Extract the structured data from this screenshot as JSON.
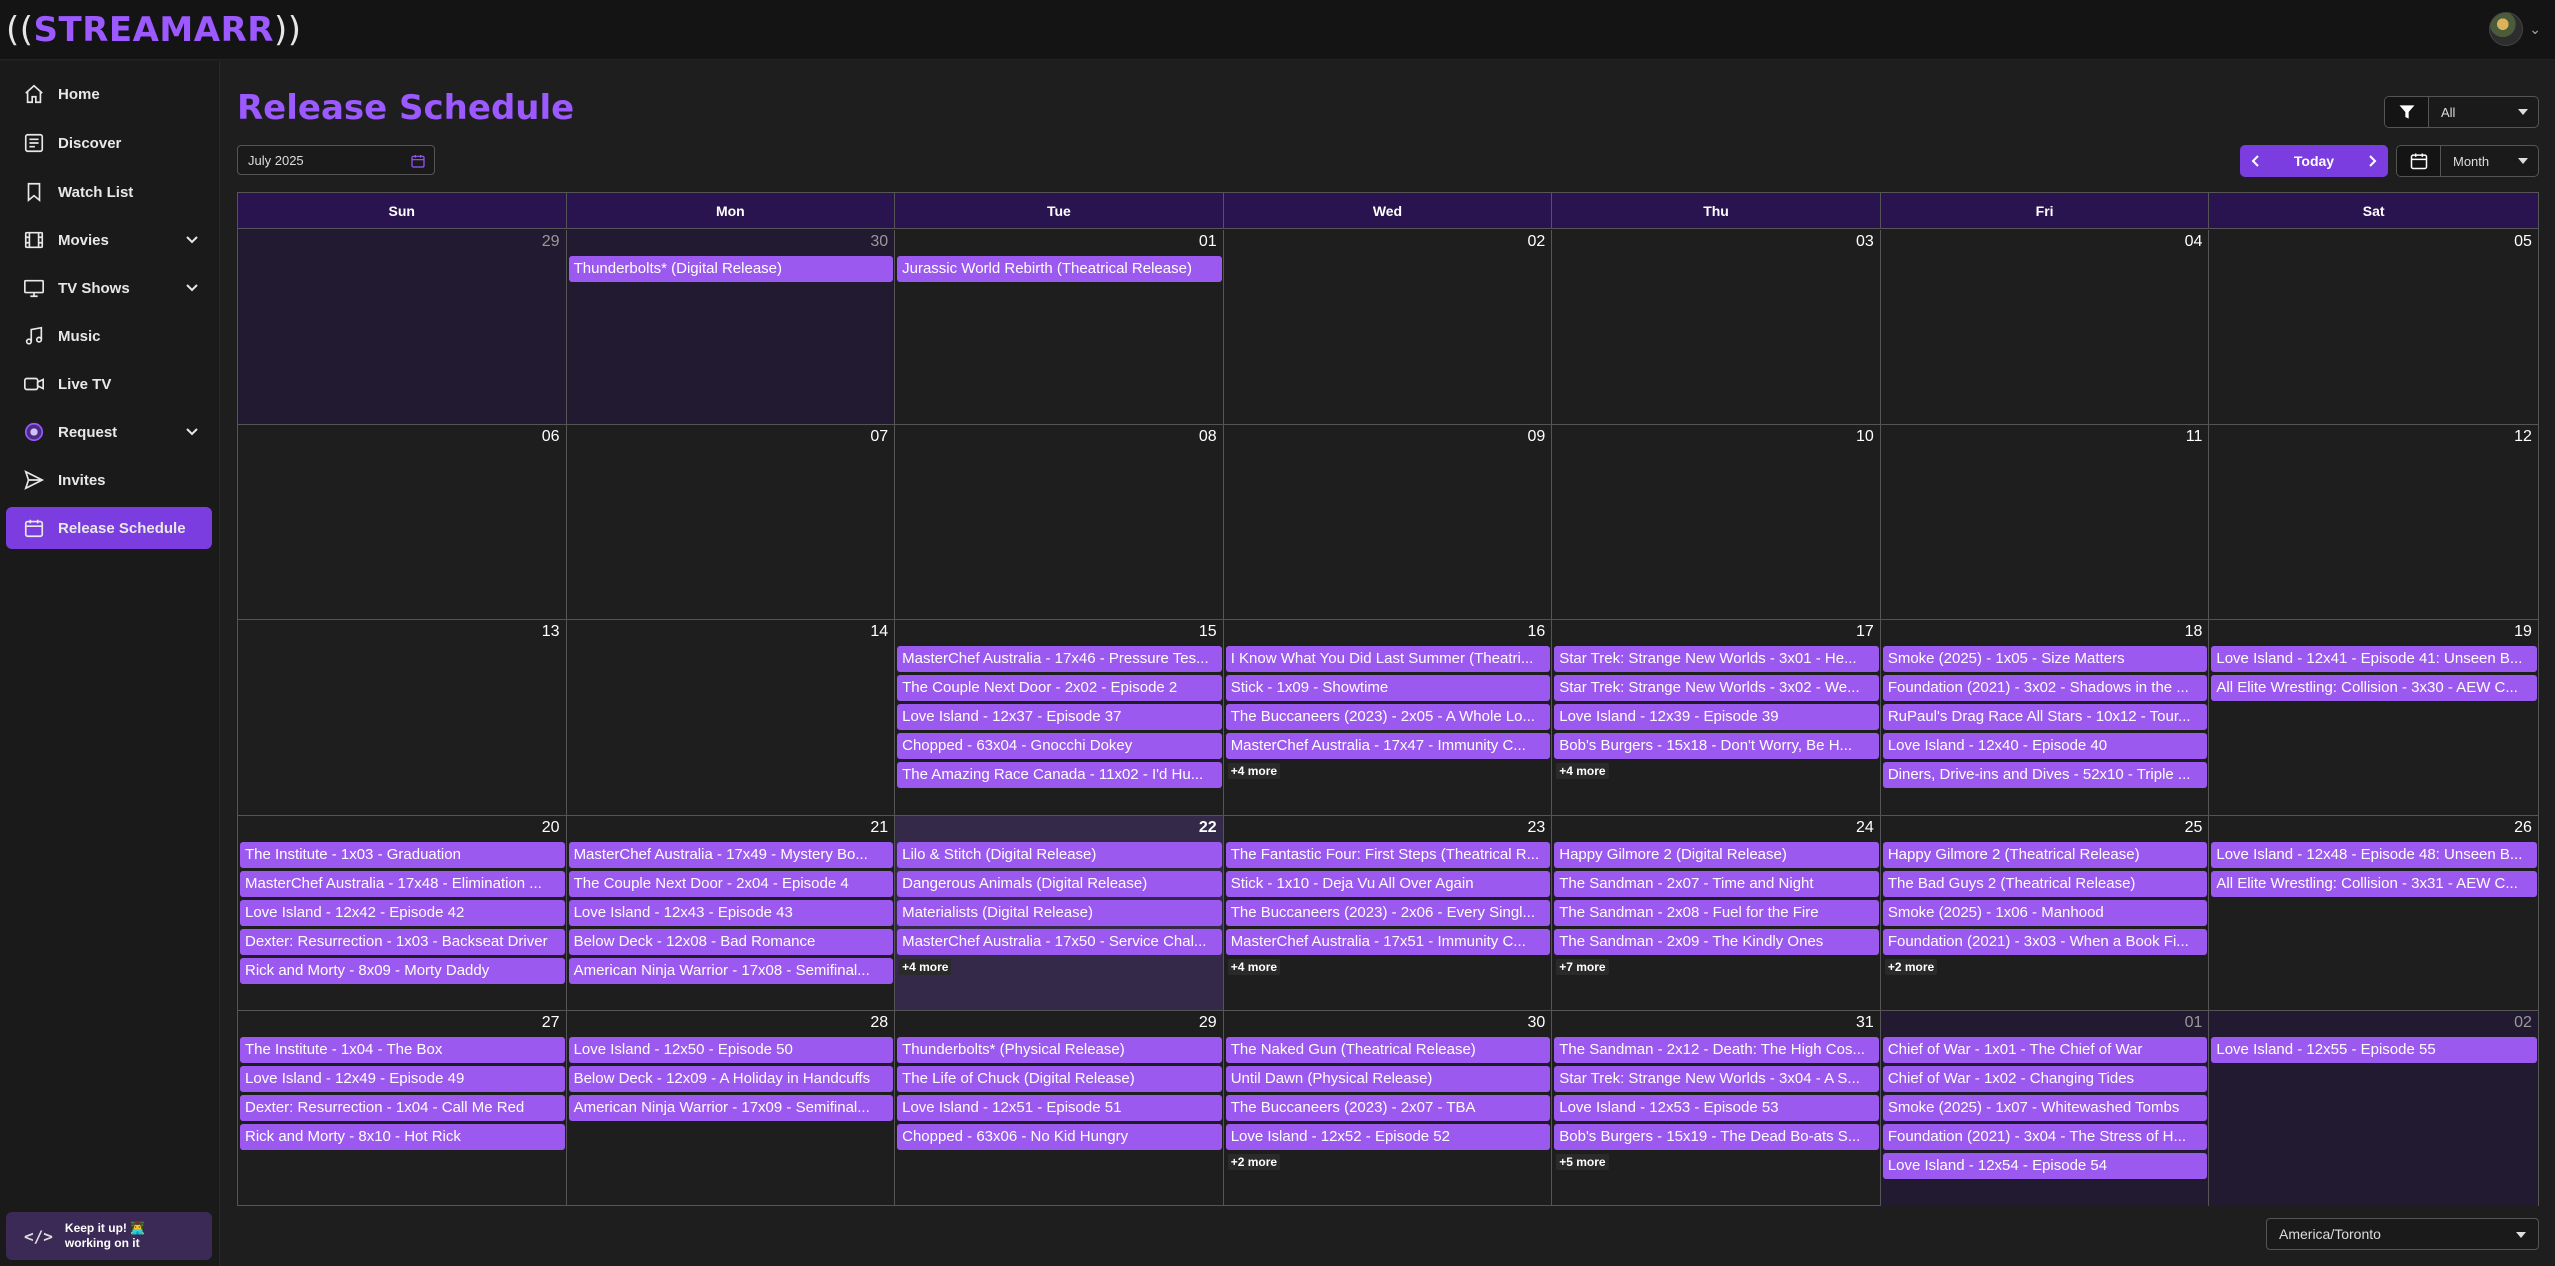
{
  "app": {
    "logo_name": "STREAMARR",
    "logo_left": "((",
    "logo_right": "))"
  },
  "sidebar": {
    "items": [
      {
        "label": "Home",
        "icon": "home-icon"
      },
      {
        "label": "Discover",
        "icon": "discover-icon"
      },
      {
        "label": "Watch List",
        "icon": "bookmark-icon"
      },
      {
        "label": "Movies",
        "icon": "film-icon",
        "expandable": true
      },
      {
        "label": "TV Shows",
        "icon": "tv-icon",
        "expandable": true
      },
      {
        "label": "Music",
        "icon": "music-icon"
      },
      {
        "label": "Live TV",
        "icon": "video-camera-icon"
      },
      {
        "label": "Request",
        "icon": "request-icon",
        "expandable": true
      },
      {
        "label": "Invites",
        "icon": "send-icon"
      },
      {
        "label": "Release Schedule",
        "icon": "calendar-icon",
        "active": true
      }
    ],
    "footer": {
      "line1": "Keep it up! 👨‍💻",
      "line2": "working on it",
      "icon": "code-icon"
    }
  },
  "header": {
    "title": "Release Schedule",
    "date_value": "July 2025",
    "filter_value": "All",
    "today_label": "Today",
    "view_value": "Month"
  },
  "calendar": {
    "weekdays": [
      "Sun",
      "Mon",
      "Tue",
      "Wed",
      "Thu",
      "Fri",
      "Sat"
    ],
    "weeks": [
      [
        {
          "day": "29",
          "other": true,
          "events": []
        },
        {
          "day": "30",
          "other": true,
          "events": [
            "Thunderbolts* (Digital Release)"
          ]
        },
        {
          "day": "01",
          "events": [
            "Jurassic World Rebirth (Theatrical Release)"
          ]
        },
        {
          "day": "02",
          "events": []
        },
        {
          "day": "03",
          "events": []
        },
        {
          "day": "04",
          "events": []
        },
        {
          "day": "05",
          "events": []
        }
      ],
      [
        {
          "day": "06",
          "events": []
        },
        {
          "day": "07",
          "events": []
        },
        {
          "day": "08",
          "events": []
        },
        {
          "day": "09",
          "events": []
        },
        {
          "day": "10",
          "events": []
        },
        {
          "day": "11",
          "events": []
        },
        {
          "day": "12",
          "events": []
        }
      ],
      [
        {
          "day": "13",
          "events": []
        },
        {
          "day": "14",
          "events": []
        },
        {
          "day": "15",
          "events": [
            "MasterChef Australia - 17x46 - Pressure Tes...",
            "The Couple Next Door - 2x02 - Episode 2",
            "Love Island - 12x37 - Episode 37",
            "Chopped - 63x04 - Gnocchi Dokey",
            "The Amazing Race Canada - 11x02 - I'd Hu..."
          ]
        },
        {
          "day": "16",
          "events": [
            "I Know What You Did Last Summer (Theatri...",
            "Stick - 1x09 - Showtime",
            "The Buccaneers (2023) - 2x05 - A Whole Lo...",
            "MasterChef Australia - 17x47 - Immunity C..."
          ],
          "more": "+4 more"
        },
        {
          "day": "17",
          "events": [
            "Star Trek: Strange New Worlds - 3x01 - He...",
            "Star Trek: Strange New Worlds - 3x02 - We...",
            "Love Island - 12x39 - Episode 39",
            "Bob's Burgers - 15x18 - Don't Worry, Be H..."
          ],
          "more": "+4 more"
        },
        {
          "day": "18",
          "events": [
            "Smoke (2025) - 1x05 - Size Matters",
            "Foundation (2021) - 3x02 - Shadows in the ...",
            "RuPaul's Drag Race All Stars - 10x12 - Tour...",
            "Love Island - 12x40 - Episode 40",
            "Diners, Drive-ins and Dives - 52x10 - Triple ..."
          ]
        },
        {
          "day": "19",
          "events": [
            "Love Island - 12x41 - Episode 41: Unseen B...",
            "All Elite Wrestling: Collision - 3x30 - AEW C..."
          ]
        }
      ],
      [
        {
          "day": "20",
          "events": [
            "The Institute - 1x03 - Graduation",
            "MasterChef Australia - 17x48 - Elimination ...",
            "Love Island - 12x42 - Episode 42",
            "Dexter: Resurrection - 1x03 - Backseat Driver",
            "Rick and Morty - 8x09 - Morty Daddy"
          ]
        },
        {
          "day": "21",
          "events": [
            "MasterChef Australia - 17x49 - Mystery Bo...",
            "The Couple Next Door - 2x04 - Episode 4",
            "Love Island - 12x43 - Episode 43",
            "Below Deck - 12x08 - Bad Romance",
            "American Ninja Warrior - 17x08 - Semifinal..."
          ]
        },
        {
          "day": "22",
          "today": true,
          "events": [
            "Lilo & Stitch (Digital Release)",
            "Dangerous Animals (Digital Release)",
            "Materialists (Digital Release)",
            "MasterChef Australia - 17x50 - Service Chal..."
          ],
          "more": "+4 more"
        },
        {
          "day": "23",
          "events": [
            "The Fantastic Four: First Steps (Theatrical R...",
            "Stick - 1x10 - Deja Vu All Over Again",
            "The Buccaneers (2023) - 2x06 - Every Singl...",
            "MasterChef Australia - 17x51 - Immunity C..."
          ],
          "more": "+4 more"
        },
        {
          "day": "24",
          "events": [
            "Happy Gilmore 2 (Digital Release)",
            "The Sandman - 2x07 - Time and Night",
            "The Sandman - 2x08 - Fuel for the Fire",
            "The Sandman - 2x09 - The Kindly Ones"
          ],
          "more": "+7 more"
        },
        {
          "day": "25",
          "events": [
            "Happy Gilmore 2 (Theatrical Release)",
            "The Bad Guys 2 (Theatrical Release)",
            "Smoke (2025) - 1x06 - Manhood",
            "Foundation (2021) - 3x03 - When a Book Fi..."
          ],
          "more": "+2 more"
        },
        {
          "day": "26",
          "events": [
            "Love Island - 12x48 - Episode 48: Unseen B...",
            "All Elite Wrestling: Collision - 3x31 - AEW C..."
          ]
        }
      ],
      [
        {
          "day": "27",
          "events": [
            "The Institute - 1x04 - The Box",
            "Love Island - 12x49 - Episode 49",
            "Dexter: Resurrection - 1x04 - Call Me Red",
            "Rick and Morty - 8x10 - Hot Rick"
          ]
        },
        {
          "day": "28",
          "events": [
            "Love Island - 12x50 - Episode 50",
            "Below Deck - 12x09 - A Holiday in Handcuffs",
            "American Ninja Warrior - 17x09 - Semifinal..."
          ]
        },
        {
          "day": "29",
          "events": [
            "Thunderbolts* (Physical Release)",
            "The Life of Chuck (Digital Release)",
            "Love Island - 12x51 - Episode 51",
            "Chopped - 63x06 - No Kid Hungry"
          ]
        },
        {
          "day": "30",
          "events": [
            "The Naked Gun (Theatrical Release)",
            "Until Dawn (Physical Release)",
            "The Buccaneers (2023) - 2x07 - TBA",
            "Love Island - 12x52 - Episode 52"
          ],
          "more": "+2 more"
        },
        {
          "day": "31",
          "events": [
            "The Sandman - 2x12 - Death: The High Cos...",
            "Star Trek: Strange New Worlds - 3x04 - A S...",
            "Love Island - 12x53 - Episode 53",
            "Bob's Burgers - 15x19 - The Dead Bo-ats S..."
          ],
          "more": "+5 more"
        },
        {
          "day": "01",
          "other": true,
          "events": [
            "Chief of War - 1x01 - The Chief of War",
            "Chief of War - 1x02 - Changing Tides",
            "Smoke (2025) - 1x07 - Whitewashed Tombs",
            "Foundation (2021) - 3x04 - The Stress of H...",
            "Love Island - 12x54 - Episode 54"
          ]
        },
        {
          "day": "02",
          "other": true,
          "events": [
            "Love Island - 12x55 - Episode 55"
          ]
        }
      ]
    ]
  },
  "footer": {
    "timezone": "America/Toronto"
  },
  "colors": {
    "accent": "#9b59ff",
    "event": "#9b59ef",
    "active_nav": "#7b3ce0",
    "header_bg": "#2a1450"
  }
}
